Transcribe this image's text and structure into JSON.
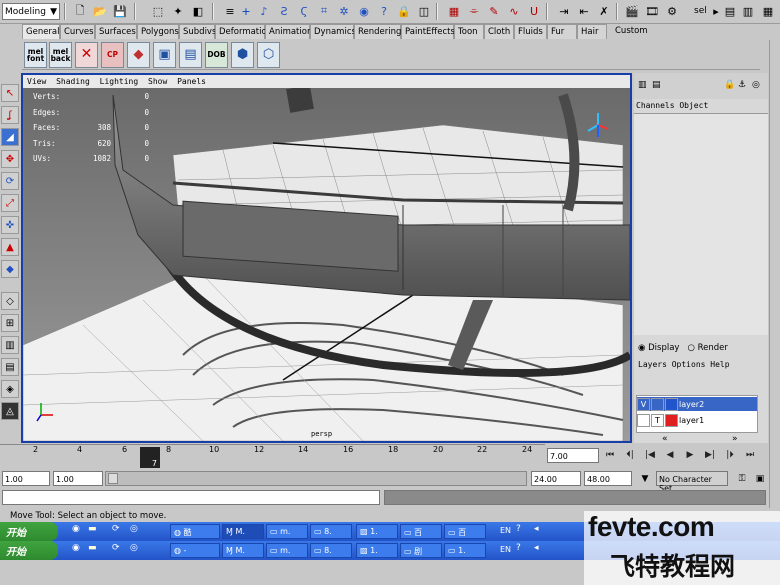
{
  "status_line": {
    "mode_value": "Modeling",
    "search_label": "sel"
  },
  "shelf_tabs": [
    "General",
    "Curves",
    "Surfaces",
    "Polygons",
    "Subdivs",
    "Deformation",
    "Animation",
    "Dynamics",
    "Rendering",
    "PaintEffects",
    "Toon",
    "Cloth",
    "Fluids",
    "Fur",
    "Hair",
    "Custom"
  ],
  "shelf_buttons": [
    {
      "label": "mel font",
      "color": "#dfe7ef"
    },
    {
      "label": "mel back",
      "color": "#dfe7ef"
    },
    {
      "label": "CP",
      "color": "#e8c0c0"
    },
    {
      "label": "DOB",
      "color": "#d8e8d8"
    }
  ],
  "viewport": {
    "menu": [
      "View",
      "Shading",
      "Lighting",
      "Show",
      "Panels"
    ],
    "hud": [
      {
        "label": "Verts:",
        "a": "",
        "b": "0"
      },
      {
        "label": "Edges:",
        "a": "",
        "b": "0"
      },
      {
        "label": "Faces:",
        "a": "308",
        "b": "0"
      },
      {
        "label": "Tris:",
        "a": "620",
        "b": "0"
      },
      {
        "label": "UVs:",
        "a": "1082",
        "b": "0"
      }
    ],
    "camera_label": "persp"
  },
  "channel_box": {
    "menu": [
      "Channels",
      "Object"
    ],
    "radio_display": "Display",
    "radio_render": "Render",
    "layer_menu": [
      "Layers",
      "Options",
      "Help"
    ],
    "layers": [
      {
        "vis": "V",
        "type": "",
        "name": "layer2",
        "color": "#2255cc"
      },
      {
        "vis": "",
        "type": "T",
        "name": "layer1",
        "color": "#e02020"
      }
    ]
  },
  "timeline": {
    "ticks": [
      "2",
      "4",
      "6",
      "8",
      "10",
      "12",
      "14",
      "16",
      "18",
      "20",
      "22",
      "24"
    ],
    "current_frame": "7",
    "current_time_field": "7.00"
  },
  "range": {
    "start": "1.00",
    "anim_start": "1.00",
    "end": "24.00",
    "anim_end": "48.00",
    "character_set": "No Character Set"
  },
  "help_line": "Move Tool: Select an object to move.",
  "taskbar": {
    "start_label": "开始",
    "lang": "EN"
  },
  "watermark": {
    "line1": "fevte.com",
    "line2": "飞特教程网"
  }
}
